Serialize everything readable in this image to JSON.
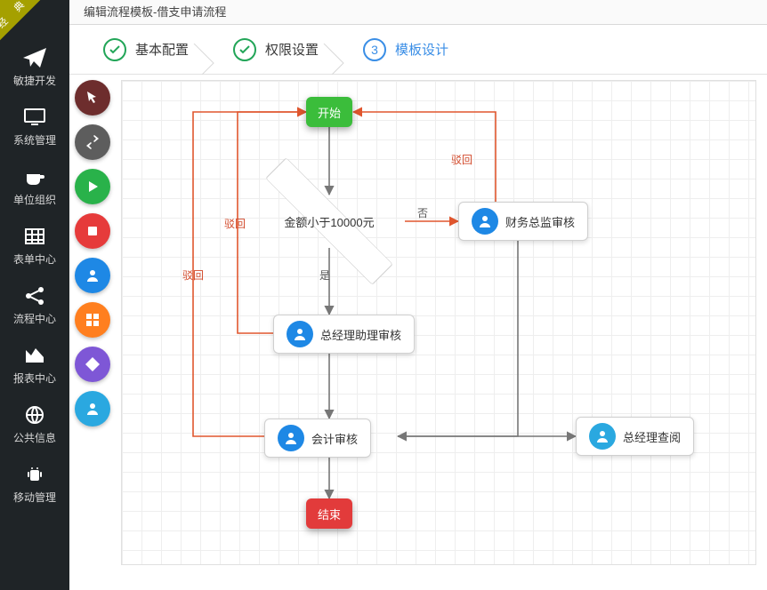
{
  "ribbon": "经 典",
  "sidebar": {
    "items": [
      {
        "label": "敏捷开发"
      },
      {
        "label": "系统管理"
      },
      {
        "label": "单位组织"
      },
      {
        "label": "表单中心"
      },
      {
        "label": "流程中心"
      },
      {
        "label": "报表中心"
      },
      {
        "label": "公共信息"
      },
      {
        "label": "移动管理"
      }
    ]
  },
  "header": {
    "title": "编辑流程模板-借支申请流程"
  },
  "steps": [
    {
      "label": "基本配置"
    },
    {
      "label": "权限设置"
    },
    {
      "num": "3",
      "label": "模板设计"
    }
  ],
  "tools": {
    "colors": [
      "#6d2d2d",
      "#5d5d5d",
      "#29b24a",
      "#e63b3b",
      "#1e88e5",
      "#ff7f1f",
      "#7e57d6",
      "#2aa8e0"
    ]
  },
  "flow": {
    "start": "开始",
    "end": "结束",
    "decision": "金额小于10000元",
    "nodes": {
      "finance": "财务总监审核",
      "assist": "总经理助理审核",
      "account": "会计审核",
      "gm": "总经理查阅"
    },
    "edgeLabels": {
      "no": "否",
      "yes": "是",
      "reject1": "驳回",
      "reject2": "驳回",
      "reject3": "驳回"
    }
  }
}
